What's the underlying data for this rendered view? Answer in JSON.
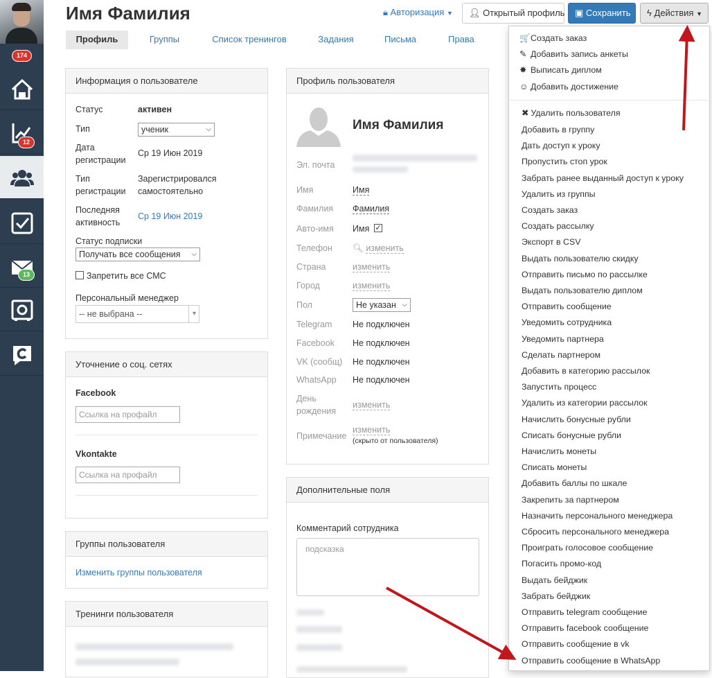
{
  "sidebar": {
    "avatar_badge": "174",
    "items": [
      {
        "icon": "home-icon"
      },
      {
        "icon": "chart-icon",
        "badge": "12"
      },
      {
        "icon": "users-icon"
      },
      {
        "icon": "checkbox-icon"
      },
      {
        "icon": "mail-icon",
        "badge": "13"
      },
      {
        "icon": "safe-icon"
      },
      {
        "icon": "logo-c-icon"
      }
    ]
  },
  "header": {
    "title": "Имя Фамилия",
    "auth_label": "Авторизация",
    "open_profile_label": "Открытый профиль",
    "save_label": "Сохранить",
    "actions_label": "Действия"
  },
  "tabs": [
    "Профиль",
    "Группы",
    "Список тренингов",
    "Задания",
    "Письма",
    "Права"
  ],
  "user_info": {
    "title": "Информация о пользователе",
    "status_label": "Статус",
    "status_value": "активен",
    "type_label": "Тип",
    "type_value": "ученик",
    "reg_date_label_1": "Дата",
    "reg_date_label_2": "регистрации",
    "reg_date_value": "Ср 19 Июн 2019",
    "reg_type_label_1": "Тип",
    "reg_type_label_2": "регистрации",
    "reg_type_value_1": "Зарегистрировался",
    "reg_type_value_2": "самостоятельно",
    "last_active_label_1": "Последняя",
    "last_active_label_2": "активность",
    "last_active_value": "Ср 19 Июн 2019",
    "subscription_label": "Статус подписки",
    "subscription_value": "Получать все сообщения",
    "sms_label": "Запретить все СМС",
    "manager_label": "Персональный менеджер",
    "manager_value": "-- не выбрана --"
  },
  "social": {
    "title": "Уточнение о соц. сетях",
    "facebook_label": "Facebook",
    "facebook_placeholder": "Ссылка на профайл",
    "vk_label": "Vkontakte",
    "vk_placeholder": "Ссылка на профайл"
  },
  "groups": {
    "title": "Группы пользователя",
    "link": "Изменить группы пользователя"
  },
  "trainings": {
    "title": "Тренинги пользователя"
  },
  "profile": {
    "title": "Профиль пользователя",
    "name": "Имя Фамилия",
    "email_label": "Эл. почта",
    "first_name_label": "Имя",
    "first_name_value": "Имя",
    "last_name_label": "Фамилия",
    "last_name_value": "Фамилия",
    "auto_name_label": "Авто-имя",
    "auto_name_value": "Имя",
    "phone_label": "Телефон",
    "phone_action": "изменить",
    "country_label": "Страна",
    "country_action": "изменить",
    "city_label": "Город",
    "city_action": "изменить",
    "gender_label": "Пол",
    "gender_value": "Не указан",
    "telegram_label": "Telegram",
    "telegram_value": "Не подключен",
    "facebook_label": "Facebook",
    "facebook_value": "Не подключен",
    "vk_label": "VK (сообщ)",
    "vk_value": "Не подключен",
    "whatsapp_label": "WhatsApp",
    "whatsapp_value": "Не подключен",
    "birthday_label_1": "День",
    "birthday_label_2": "рождения",
    "birthday_action": "изменить",
    "note_label": "Примечание",
    "note_action": "изменить",
    "note_hint": "(скрыто от пользователя)"
  },
  "extra": {
    "title": "Дополнительные поля",
    "comment_label": "Комментарий сотрудника",
    "comment_placeholder": "подсказка"
  },
  "actions_menu": {
    "top_items": [
      {
        "icon": "cart-icon",
        "glyph": "🛒",
        "label": "Создать заказ"
      },
      {
        "icon": "pencil-icon",
        "glyph": "✎",
        "label": "Добавить запись анкеты"
      },
      {
        "icon": "certificate-icon",
        "glyph": "✸",
        "label": "Выписать диплом"
      },
      {
        "icon": "smile-icon",
        "glyph": "☺",
        "label": "Добавить достижение"
      }
    ],
    "delete_label": "Удалить пользователя",
    "items": [
      "Добавить в группу",
      "Дать доступ к уроку",
      "Пропустить стоп урок",
      "Забрать ранее выданный доступ к уроку",
      "Удалить из группы",
      "Создать заказ",
      "Создать рассылку",
      "Экспорт в CSV",
      "Выдать пользователю скидку",
      "Отправить письмо по рассылке",
      "Выдать пользователю диплом",
      "Отправить сообщение",
      "Уведомить сотрудника",
      "Уведомить партнера",
      "Сделать партнером",
      "Добавить в категорию рассылок",
      "Запустить процесс",
      "Удалить из категории рассылок",
      "Начислить бонусные рубли",
      "Списать бонусные рубли",
      "Начислить монеты",
      "Списать монеты",
      "Добавить баллы по шкале",
      "Закрепить за партнером",
      "Назначить персонального менеджера",
      "Сбросить персонального менеджера",
      "Проиграть голосовое сообщение",
      "Погасить промо-код",
      "Выдать бейджик",
      "Забрать бейджик",
      "Отправить telegram сообщение",
      "Отправить facebook сообщение",
      "Отправить сообщение в vk",
      "Отправить сообщение в WhatsApp"
    ]
  },
  "colors": {
    "link": "#337ab7",
    "sidebar": "#2c3e50",
    "badge_red": "#d9342b",
    "badge_green": "#5cb85c",
    "arrow": "#c0171d"
  }
}
